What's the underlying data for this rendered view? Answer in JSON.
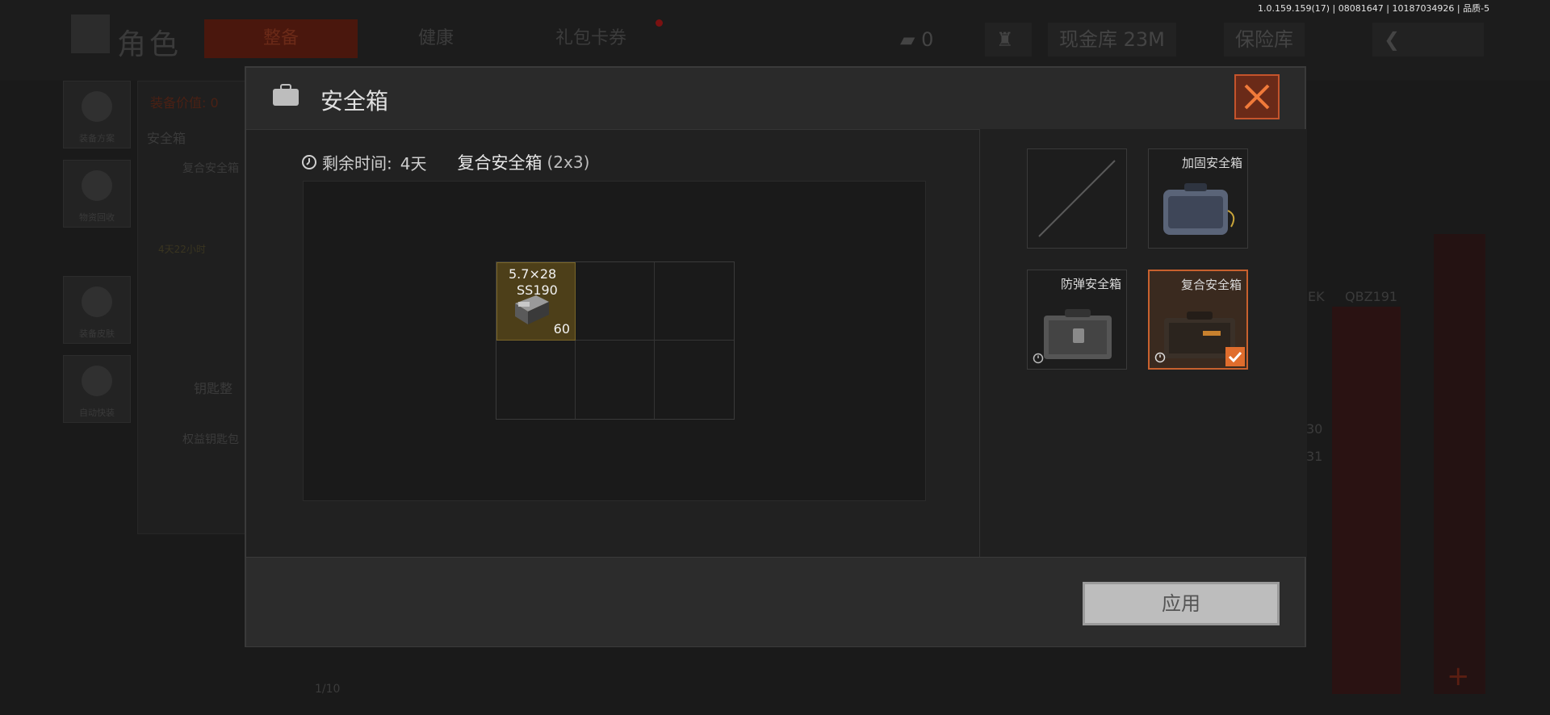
{
  "version_info": "1.0.159.159(17) | 08081647 | 10187034926 | 品质-5",
  "background": {
    "title": "角色",
    "tabs": [
      "整备",
      "健康",
      "礼包卡券"
    ],
    "currency_count": "0",
    "cash_store": "现金库 23M",
    "vault": "保险库",
    "side_buttons": [
      "装备方案",
      "物资回收",
      "装备皮肤",
      "自动快装"
    ],
    "equip_value_label": "装备价值: 0",
    "safebox_label": "安全箱",
    "safebox_item": "复合安全箱",
    "safebox_timer": "4天22小时",
    "key_label": "钥匙整",
    "key_item": "权益钥匙包",
    "bottom_count": "1/10",
    "weapons": [
      "EK",
      "QBZ191"
    ],
    "numbers": [
      "30",
      "31"
    ]
  },
  "modal": {
    "title": "安全箱",
    "remaining_label": "剩余时间:",
    "remaining_value": "4天",
    "case_name": "复合安全箱",
    "case_size": "(2x3)",
    "item": {
      "name_line1": "5.7×28",
      "name_line2": "SS190",
      "count": "60"
    },
    "slots": [
      {
        "label": "",
        "state": "empty"
      },
      {
        "label": "加固安全箱",
        "state": "owned"
      },
      {
        "label": "防弹安全箱",
        "state": "timed"
      },
      {
        "label": "复合安全箱",
        "state": "selected"
      }
    ],
    "apply_label": "应用"
  },
  "colors": {
    "accent_orange": "#e06d2d",
    "item_gold": "#4d3f19",
    "close_red": "#6a2a18"
  }
}
